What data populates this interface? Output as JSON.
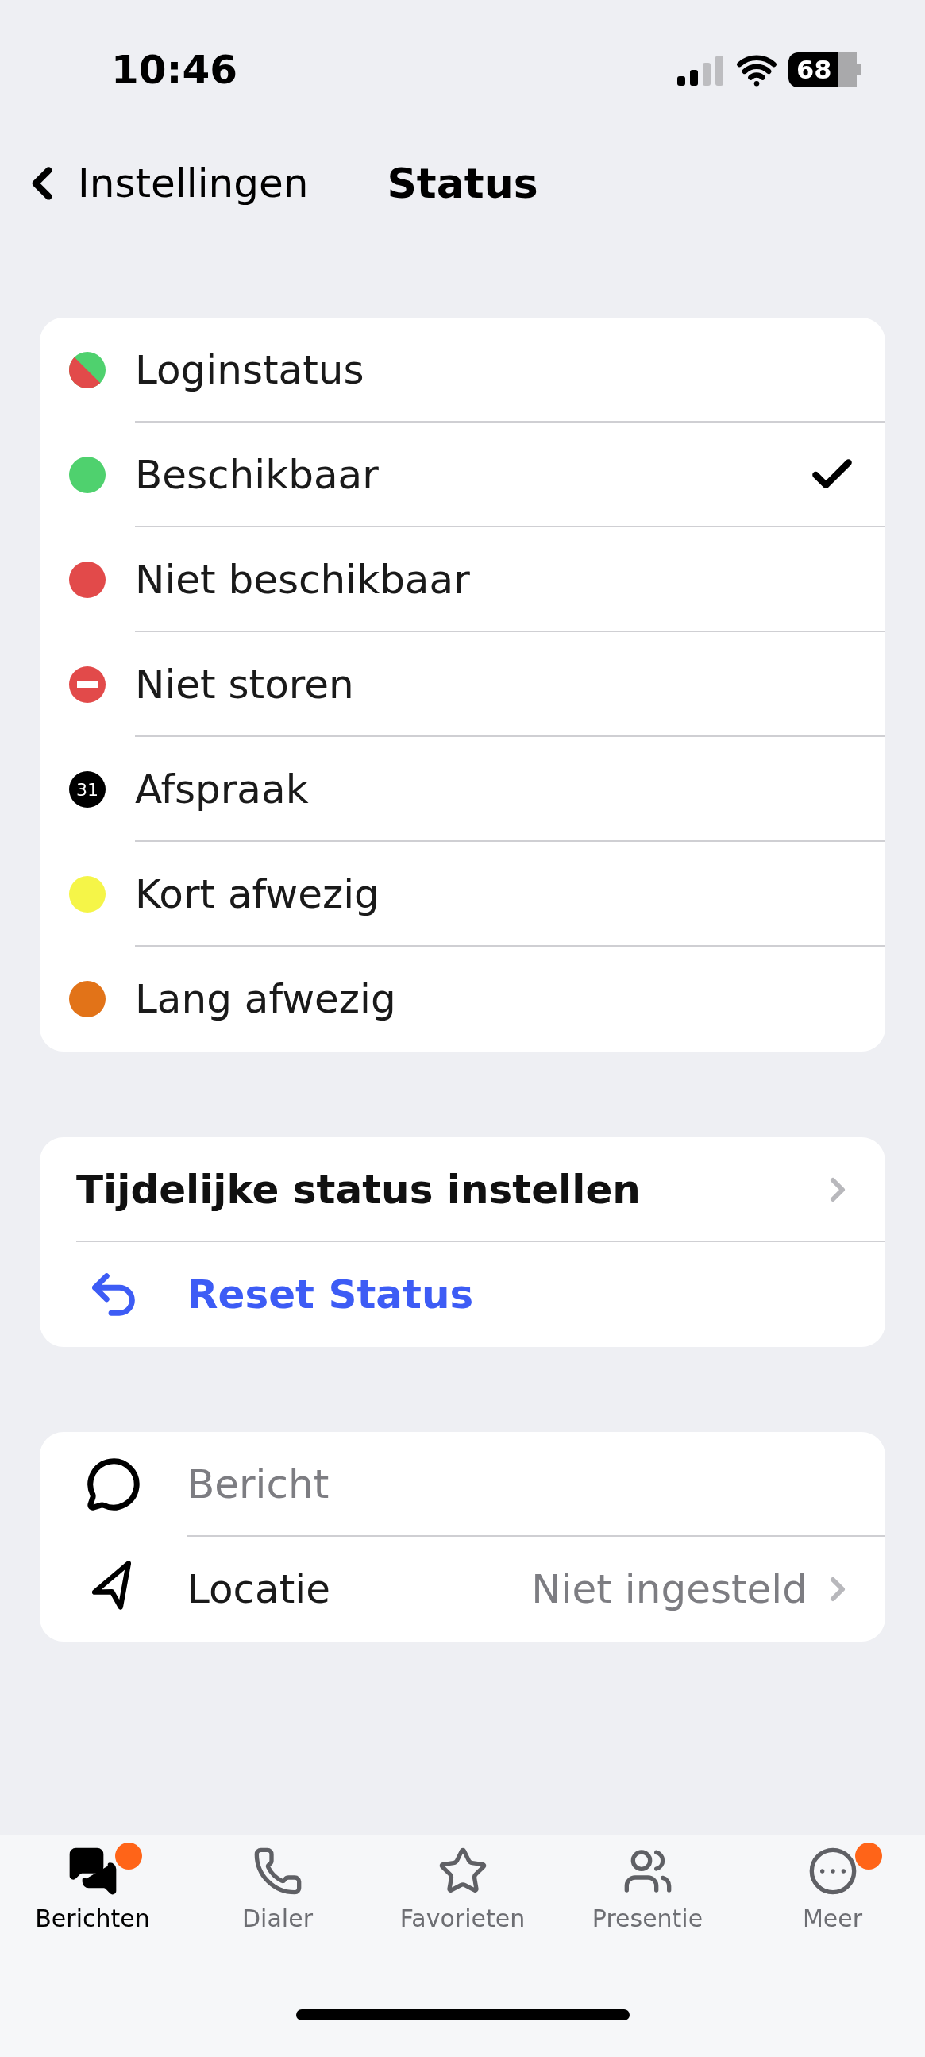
{
  "status_bar": {
    "time": "10:46",
    "battery": "68"
  },
  "nav": {
    "back": "Instellingen",
    "title": "Status"
  },
  "statuses": [
    {
      "label": "Loginstatus",
      "kind": "split",
      "color": "#e24a4a",
      "selected": false
    },
    {
      "label": "Beschikbaar",
      "kind": "dot",
      "color": "#4fd16e",
      "selected": true
    },
    {
      "label": "Niet beschikbaar",
      "kind": "dot",
      "color": "#e24a4a",
      "selected": false
    },
    {
      "label": "Niet storen",
      "kind": "blocked",
      "color": "#e24a4a",
      "selected": false
    },
    {
      "label": "Afspraak",
      "kind": "calendar",
      "color": "#000000",
      "badge": "31",
      "selected": false
    },
    {
      "label": "Kort afwezig",
      "kind": "dot",
      "color": "#f5f548",
      "selected": false
    },
    {
      "label": "Lang afwezig",
      "kind": "dot",
      "color": "#e27318",
      "selected": false
    }
  ],
  "temporary": {
    "label": "Tijdelijke status instellen",
    "reset": "Reset Status"
  },
  "message": {
    "placeholder": "Bericht"
  },
  "location": {
    "label": "Locatie",
    "value": "Niet ingesteld"
  },
  "tabs": [
    {
      "label": "Berichten",
      "kind": "messages",
      "selected": true,
      "badge": true
    },
    {
      "label": "Dialer",
      "kind": "phone",
      "selected": false,
      "badge": false
    },
    {
      "label": "Favorieten",
      "kind": "star",
      "selected": false,
      "badge": false
    },
    {
      "label": "Presentie",
      "kind": "people",
      "selected": false,
      "badge": false
    },
    {
      "label": "Meer",
      "kind": "more",
      "selected": false,
      "badge": true
    }
  ]
}
